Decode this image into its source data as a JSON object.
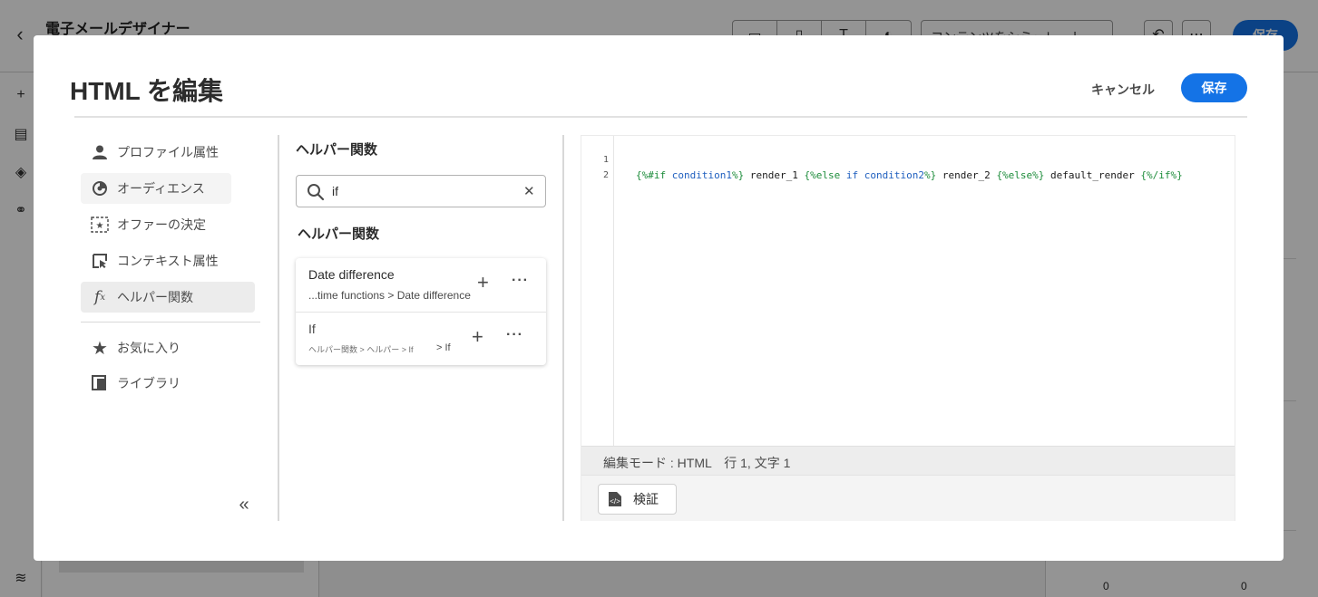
{
  "background": {
    "title": "電子メールデザイナー",
    "simulate_label": "コンテンツをシミュレート",
    "save_label": "保存",
    "stepper_a": "0",
    "stepper_b": "0"
  },
  "dialog": {
    "title": "HTML を編集",
    "cancel_label": "キャンセル",
    "save_label": "保存",
    "accent_color": "#1473e6"
  },
  "nav": {
    "items": [
      {
        "label": "プロファイル属性",
        "icon": "person-icon"
      },
      {
        "label": "オーディエンス",
        "icon": "audience-icon"
      },
      {
        "label": "オファーの決定",
        "icon": "offer-decision-icon"
      },
      {
        "label": "コンテキスト属性",
        "icon": "context-attribute-icon"
      },
      {
        "label": "ヘルパー関数",
        "icon": "function-icon"
      },
      {
        "label": "お気に入り",
        "icon": "star-icon"
      },
      {
        "label": "ライブラリ",
        "icon": "library-icon"
      }
    ]
  },
  "helpers": {
    "heading": "ヘルパー関数",
    "search_value": "if",
    "results_heading": "ヘルパー関数",
    "results": [
      {
        "title": "Date difference",
        "path": "...time functions > Date difference"
      },
      {
        "title": "If",
        "path": "ヘルパー関数 > ヘルパー > If",
        "path_suffix": "> If"
      }
    ]
  },
  "editor": {
    "line_numbers": [
      "1",
      "2"
    ],
    "code": {
      "open_if": "{%#if",
      "cond1": " condition1",
      "close1": "%}",
      "render1": " render_1 ",
      "open_else_if": "{%else",
      "kw_if": " if",
      "cond2": " condition2",
      "close2": "%}",
      "render2": " render_2 ",
      "open_else": "{%else%}",
      "default_render": " default_render ",
      "endif": "{%/if%}"
    },
    "status": "編集モード : HTML　行 1, 文字 1",
    "validate_label": "検証"
  }
}
